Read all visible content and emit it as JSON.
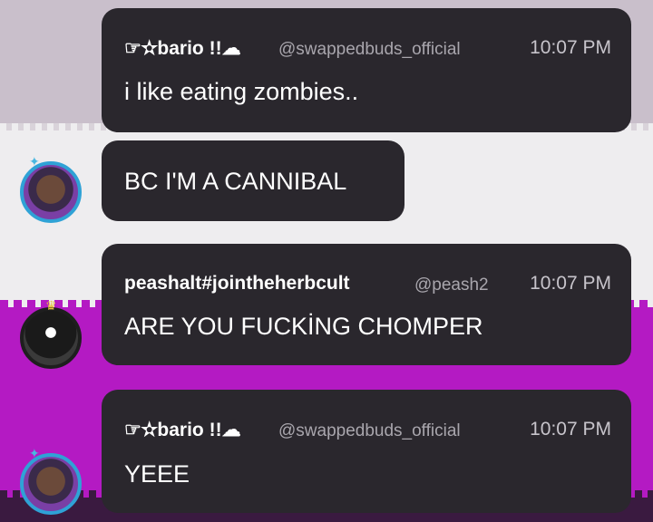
{
  "messages": [
    {
      "name": "☞✫bario !!☁",
      "handle": "@swappedbuds_official",
      "time": "10:07 PM",
      "text": "i like eating zombies.."
    },
    {
      "text": "BC I'M A CANNIBAL"
    },
    {
      "name": "peashalt#jointheherbcult",
      "handle": "@peash2",
      "time": "10:07 PM",
      "text": "ARE YOU FUCKİNG CHOMPER"
    },
    {
      "name": "☞✫bario !!☁",
      "handle": "@swappedbuds_official",
      "time": "10:07 PM",
      "text": "YEEE"
    }
  ],
  "avatar_icons": [
    "bario-avatar-icon",
    "peashalt-avatar-icon",
    "bario-avatar-icon"
  ],
  "colors": {
    "bubble": "#2a272d",
    "handle": "#a9a6ad",
    "magenta_bg": "#b41ac3",
    "avatar_ring_blue": "#2fa2d6"
  }
}
